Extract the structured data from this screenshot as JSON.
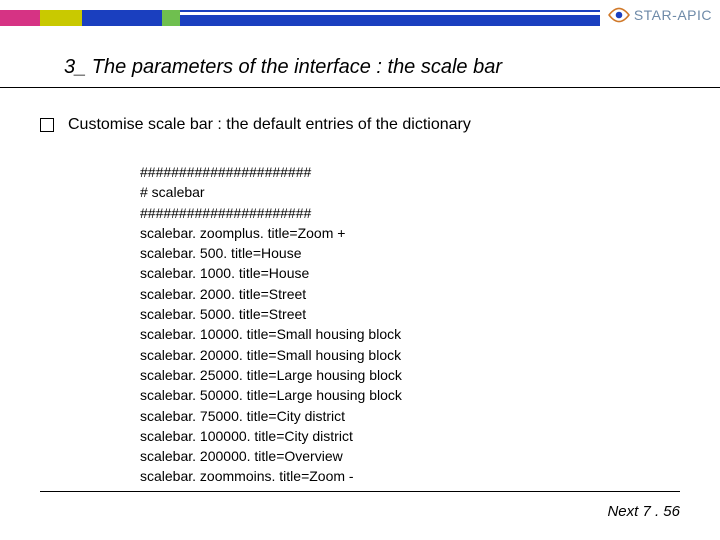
{
  "brand": {
    "word1": "STAR",
    "dash": "-",
    "word2": "APIC"
  },
  "title": "3_ The parameters of the interface : the scale bar",
  "bullet": "Customise scale bar : the default entries of the dictionary",
  "code_lines": [
    "######################",
    "# scalebar",
    "######################",
    "scalebar. zoomplus. title=Zoom +",
    "scalebar. 500. title=House",
    "scalebar. 1000. title=House",
    "scalebar. 2000. title=Street",
    "scalebar. 5000. title=Street",
    "scalebar. 10000. title=Small housing block",
    "scalebar. 20000. title=Small housing block",
    "scalebar. 25000. title=Large housing block",
    "scalebar. 50000. title=Large housing block",
    "scalebar. 75000. title=City district",
    "scalebar. 100000. title=City district",
    "scalebar. 200000. title=Overview",
    "scalebar. zoommoins. title=Zoom -"
  ],
  "footer": "Next 7 . 56"
}
